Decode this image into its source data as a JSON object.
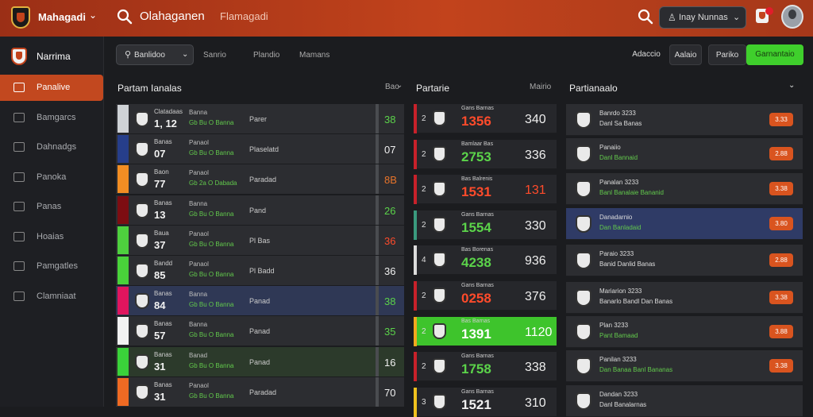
{
  "topbar": {
    "brand": "Mahagadi",
    "search_main": "Olahaganen",
    "search_sub": "Flamagadi",
    "select_label": "Inay Nunnas"
  },
  "sidebar": {
    "title": "Narrima",
    "items": [
      {
        "label": "Panalive",
        "active": true
      },
      {
        "label": "Bamgarcs",
        "active": false
      },
      {
        "label": "Dahnadgs",
        "active": false
      },
      {
        "label": "Panoka",
        "active": false
      },
      {
        "label": "Panas",
        "active": false
      },
      {
        "label": "Hoaias",
        "active": false
      },
      {
        "label": "Pamgatles",
        "active": false
      },
      {
        "label": "Clamniaat",
        "active": false
      }
    ]
  },
  "filters": {
    "select_label": "Banlidoo",
    "tabs": [
      "Sanrio",
      "Plandio",
      "Mamans"
    ],
    "right_buttons": [
      "Adaccio",
      "Aalaio",
      "Pariko",
      "Garnantaio"
    ]
  },
  "left_panel": {
    "title": "Partam Ianalas",
    "side_label": "Bao",
    "rows": [
      {
        "team": "Clatadaas",
        "num": "1, 12",
        "l1": "Banna",
        "l2": "Gb Bu O Banna",
        "name": "Parer",
        "score": "38",
        "score_color": "#5bd34a",
        "bar_color": "#cfd2d6"
      },
      {
        "team": "Banas",
        "num": "07",
        "l1": "Panaol",
        "l2": "Gb Bu O Banna",
        "name": "Plaselatd",
        "score": "07",
        "score_color": "#f0f0f0",
        "bar_color": "#263e8a"
      },
      {
        "team": "Baon",
        "num": "77",
        "l1": "Panaol",
        "l2": "Gb 2a O Dabada",
        "name": "Paradad",
        "score": "8B",
        "score_color": "#e8742a",
        "bar_color": "#f28d23"
      },
      {
        "team": "Banas",
        "num": "13",
        "l1": "Banna",
        "l2": "Gb Bu O Banna",
        "name": "Pand",
        "score": "26",
        "score_color": "#5bd34a",
        "bar_color": "#7d0d12"
      },
      {
        "team": "Baua",
        "num": "37",
        "l1": "Panaol",
        "l2": "Gb Bu O Banna",
        "name": "Pl Bas",
        "score": "36",
        "score_color": "#ff4b2b",
        "bar_color": "#4ed03e"
      },
      {
        "team": "Bandd",
        "num": "85",
        "l1": "Panaol",
        "l2": "Gb Bu O Banna",
        "name": "Pl Badd",
        "score": "36",
        "score_color": "#f0f0f0",
        "bar_color": "#49d23a"
      },
      {
        "team": "Banas",
        "num": "84",
        "l1": "Banna",
        "l2": "Gb Bu O Banna",
        "name": "Panad",
        "score": "38",
        "score_color": "#5bd34a",
        "bar_color": "#e0155e"
      },
      {
        "team": "Banas",
        "num": "57",
        "l1": "Banna",
        "l2": "Gb Bu O Banna",
        "name": "Panad",
        "score": "35",
        "score_color": "#5bd34a",
        "bar_color": "#f2f2f2"
      },
      {
        "team": "Banas",
        "num": "31",
        "l1": "Banad",
        "l2": "Gb Bu O Banna",
        "name": "Panad",
        "score": "16",
        "score_color": "#f0f0f0",
        "bar_color": "#3ad23a"
      },
      {
        "team": "Banas",
        "num": "31",
        "l1": "Panaol",
        "l2": "Gb Bu O Banna",
        "name": "Paradad",
        "score": "70",
        "score_color": "#f0f0f0",
        "bar_color": "#ef6a23"
      }
    ]
  },
  "middle_panel": {
    "title": "Partarie",
    "side_label": "Mairio",
    "rows": [
      {
        "rank": "2",
        "small": "Gans Barnas",
        "big": "1356",
        "big_color": "#ff4b2b",
        "right": "340",
        "right_color": "#eeeeee",
        "bar_color": "#c8212a"
      },
      {
        "rank": "2",
        "small": "Bamlaar Bas",
        "big": "2753",
        "big_color": "#5bd34a",
        "right": "336",
        "right_color": "#eeeeee",
        "bar_color": "#c8212a"
      },
      {
        "rank": "2",
        "small": "Bas Balrenis",
        "big": "1531",
        "big_color": "#ff4b2b",
        "right": "131",
        "right_color": "#ff4b2b",
        "bar_color": "#c8212a"
      },
      {
        "rank": "2",
        "small": "Gans Barnas",
        "big": "1554",
        "big_color": "#5bd34a",
        "right": "330",
        "right_color": "#eeeeee",
        "bar_color": "#3a9a7e"
      },
      {
        "rank": "4",
        "small": "Bas Borenas",
        "big": "4238",
        "big_color": "#5bd34a",
        "right": "936",
        "right_color": "#eeeeee",
        "bar_color": "#dcdcdc"
      },
      {
        "rank": "2",
        "small": "Gans Barnas",
        "big": "0258",
        "big_color": "#ff4b2b",
        "right": "376",
        "right_color": "#eeeeee",
        "bar_color": "#c8212a"
      },
      {
        "rank": "2",
        "small": "Bas Barnas",
        "big": "1391",
        "big_color": "#ffffff",
        "right": "1120",
        "right_color": "#ffffff",
        "bar_color": "#f2a81e",
        "highlight": true
      },
      {
        "rank": "2",
        "small": "Gans Barnas",
        "big": "1758",
        "big_color": "#5bd34a",
        "right": "338",
        "right_color": "#eeeeee",
        "bar_color": "#c8212a"
      },
      {
        "rank": "3",
        "small": "Gans Barnas",
        "big": "1521",
        "big_color": "#f0f0f0",
        "right": "310",
        "right_color": "#eeeeee",
        "bar_color": "#f0c21e"
      }
    ]
  },
  "right_panel": {
    "title": "Partianaalo",
    "cards": [
      {
        "t1": "Banrdo 3233",
        "t2": "Danl Sa Banas",
        "t2_color": "#dddddd",
        "pill": "3.33",
        "selected": false
      },
      {
        "t1": "Panaiio",
        "t2": "Danl Bannaid",
        "t2_color": "#62c94c",
        "pill": "2.88",
        "selected": false
      },
      {
        "t1": "Panalan 3233",
        "t2": "Banl Banalaie Bananid",
        "t2_color": "#62c94c",
        "pill": "3.38",
        "selected": false
      },
      {
        "t1": "Danadarnio",
        "t2": "Dan Banladaid",
        "t2_color": "#62c94c",
        "pill": "3.80",
        "selected": true
      },
      {
        "t1": "Paraio 3233",
        "t2": "Banid Danlid Banas",
        "t2_color": "#dddddd",
        "pill": "2.88",
        "selected": false
      },
      {
        "t1": "Mariarion 3233",
        "t2": "Banarlo Bandl Dan Banas",
        "t2_color": "#dddddd",
        "pill": "3.38",
        "selected": false
      },
      {
        "t1": "Plan 3233",
        "t2": "Pant Bamaad",
        "t2_color": "#62c94c",
        "pill": "3.88",
        "selected": false
      },
      {
        "t1": "Panilan 3233",
        "t2": "Dan Banaa Banl Bananas",
        "t2_color": "#62c94c",
        "pill": "3.38",
        "selected": false
      },
      {
        "t1": "Dandan 3233",
        "t2": "Danl Banalarnas",
        "t2_color": "#dddddd",
        "pill": "",
        "selected": false
      }
    ]
  }
}
